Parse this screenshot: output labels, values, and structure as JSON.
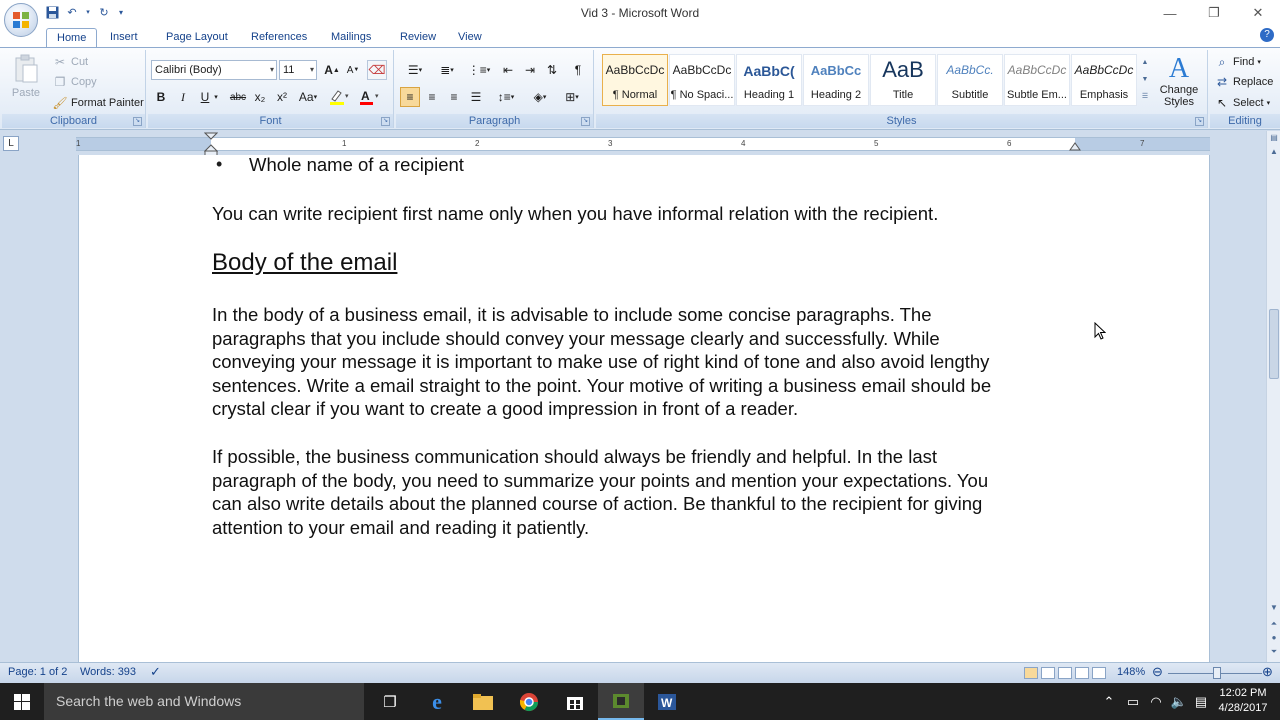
{
  "window": {
    "title": "Vid 3 - Microsoft Word",
    "minimize": "—",
    "restore": "❐",
    "close": "✕"
  },
  "qat": {
    "save_icon": "save-icon",
    "undo_icon": "undo-icon",
    "redo_icon": "redo-icon",
    "customize_icon": "chevron-down-icon"
  },
  "tabs": [
    "Home",
    "Insert",
    "Page Layout",
    "References",
    "Mailings",
    "Review",
    "View"
  ],
  "ribbon": {
    "clipboard": {
      "label": "Clipboard",
      "paste": "Paste",
      "cut": "Cut",
      "copy": "Copy",
      "format_painter": "Format Painter"
    },
    "font": {
      "label": "Font",
      "font_name": "Calibri (Body)",
      "font_size": "11",
      "bold": "B",
      "italic": "I",
      "underline": "U",
      "strike": "abc",
      "subscript": "x₂",
      "superscript": "x²",
      "change_case": "Aa",
      "grow": "A",
      "shrink": "A"
    },
    "paragraph": {
      "label": "Paragraph"
    },
    "styles": {
      "label": "Styles",
      "change_styles": "Change Styles",
      "items": [
        {
          "sample": "AaBbCcDc",
          "name": "¶ Normal"
        },
        {
          "sample": "AaBbCcDc",
          "name": "¶ No Spaci..."
        },
        {
          "sample": "AaBbC(",
          "name": "Heading 1"
        },
        {
          "sample": "AaBbCc",
          "name": "Heading 2"
        },
        {
          "sample": "AaB",
          "name": "Title"
        },
        {
          "sample": "AaBbCc.",
          "name": "Subtitle"
        },
        {
          "sample": "AaBbCcDc",
          "name": "Subtle Em..."
        },
        {
          "sample": "AaBbCcDc",
          "name": "Emphasis"
        }
      ]
    },
    "editing": {
      "label": "Editing",
      "find": "Find",
      "replace": "Replace",
      "select": "Select"
    }
  },
  "ruler": {
    "numbers": [
      "1",
      "1",
      "2",
      "3",
      "4",
      "5",
      "6",
      "7"
    ],
    "tab_selector": "L"
  },
  "document": {
    "bullet_item": "Whole name of a recipient",
    "para1": "You can write recipient first name only when you have informal relation with the recipient.",
    "heading": "Body of the email",
    "para2_lines": [
      "In the body of a business email, it is advisable to include some concise paragraphs. The",
      "paragraphs that you include should convey your message clearly and successfully. While",
      "conveying your message it is important to make use of right kind of tone and also avoid lengthy",
      "sentences. Write a email straight to the point. Your motive of writing a business email should be",
      "crystal clear if you want to create a good impression in front of a reader."
    ],
    "para3_lines": [
      "If possible, the business communication should always be friendly and helpful. In the last",
      "paragraph of the body, you need to summarize your points and mention your expectations. You",
      "can also write details about the planned course of action. Be thankful to the recipient for giving",
      "attention to your email and reading it patiently."
    ]
  },
  "status": {
    "page": "Page: 1 of 2",
    "words": "Words: 393",
    "zoom": "148%"
  },
  "taskbar": {
    "search_placeholder": "Search the web and Windows",
    "time": "12:02 PM",
    "date": "4/28/2017"
  },
  "colors": {
    "accent": "#2b579a",
    "ribbon_text": "#15428b",
    "highlight": "#ffff00",
    "font_color": "#ff0000"
  }
}
